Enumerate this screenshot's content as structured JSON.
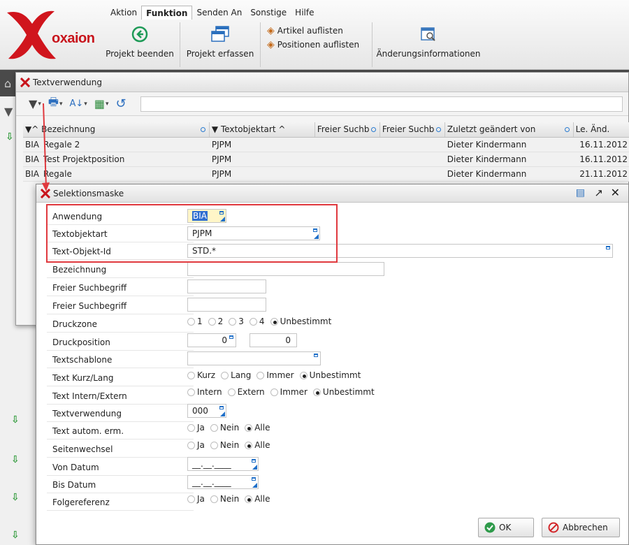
{
  "menu": [
    "Aktion",
    "Funktion",
    "Senden An",
    "Sonstige",
    "Hilfe"
  ],
  "brand": {
    "logo_text": "oxaion",
    "accent": "#c8141c"
  },
  "ribbon": {
    "projekt_beenden": "Projekt beenden",
    "projekt_erfassen": "Projekt erfassen",
    "artikel_auflisten": "Artikel auflisten",
    "positionen_auflisten": "Positionen auflisten",
    "aenderungsinformationen": "Änderungsinformationen"
  },
  "textverwendung": {
    "title": "Textverwendung",
    "columns": [
      "Bezeichnung",
      "Textobjektart",
      "Freier Suchb",
      "Freier Suchb",
      "Zuletzt geändert von",
      "Le. Änd."
    ],
    "rows": [
      {
        "app": "BIA",
        "bez": "Regale 2",
        "art": "PJPM",
        "user": "Dieter Kindermann",
        "date": "16.11.2012"
      },
      {
        "app": "BIA",
        "bez": "Test Projektposition",
        "art": "PJPM",
        "user": "Dieter Kindermann",
        "date": "16.11.2012"
      },
      {
        "app": "BIA",
        "bez": "Regale",
        "art": "PJPM",
        "user": "Dieter Kindermann",
        "date": "21.11.2012"
      }
    ]
  },
  "selektion": {
    "title": "Selektionsmaske",
    "labels": {
      "anwendung": "Anwendung",
      "textobjektart": "Textobjektart",
      "textobjektid": "Text-Objekt-Id",
      "bezeichnung": "Bezeichnung",
      "freier1": "Freier Suchbegriff",
      "freier2": "Freier Suchbegriff",
      "druckzone": "Druckzone",
      "druckposition": "Druckposition",
      "textschablone": "Textschablone",
      "kurzlang": "Text Kurz/Lang",
      "internextern": "Text Intern/Extern",
      "textverwendung": "Textverwendung",
      "autom": "Text autom. erm.",
      "seitenwechsel": "Seitenwechsel",
      "vondatum": "Von Datum",
      "bisdatum": "Bis Datum",
      "folgereferenz": "Folgereferenz"
    },
    "values": {
      "anwendung": "BIA",
      "textobjektart": "PJPM",
      "textobjektid": "STD.*",
      "druckposition1": "0",
      "druckposition2": "0",
      "textverwendung": "000",
      "vondatum": "__.__.____",
      "bisdatum": "__.__.____"
    },
    "druckzone": [
      "1",
      "2",
      "3",
      "4",
      "Unbestimmt"
    ],
    "kurzlang": [
      "Kurz",
      "Lang",
      "Immer",
      "Unbestimmt"
    ],
    "internextern": [
      "Intern",
      "Extern",
      "Immer",
      "Unbestimmt"
    ],
    "janeinalle": [
      "Ja",
      "Nein",
      "Alle"
    ],
    "ok": "OK",
    "abbrechen": "Abbrechen"
  }
}
